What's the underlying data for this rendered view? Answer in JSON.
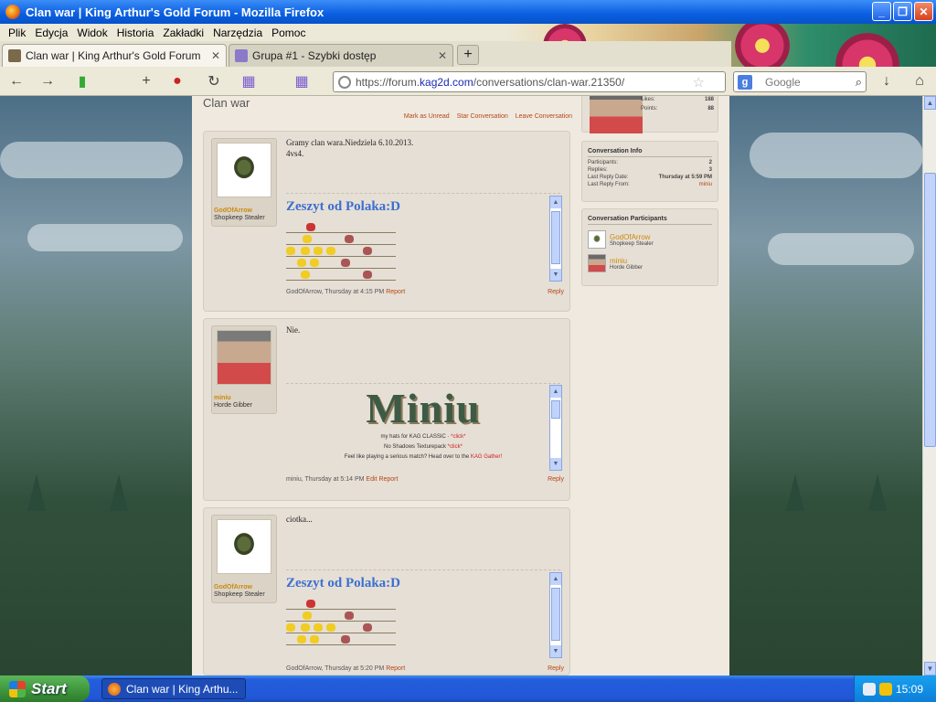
{
  "window": {
    "title": "Clan war | King Arthur's Gold Forum - Mozilla Firefox"
  },
  "menu": [
    "Plik",
    "Edycja",
    "Widok",
    "Historia",
    "Zakładki",
    "Narzędzia",
    "Pomoc"
  ],
  "tabs": [
    {
      "label": "Clan war | King Arthur's Gold Forum",
      "active": true
    },
    {
      "label": "Grupa #1 - Szybki dostęp",
      "active": false
    }
  ],
  "urlbar": {
    "prefix": "https://forum.",
    "domain": "kag2d.com",
    "path": "/conversations/clan-war.21350/"
  },
  "search": {
    "placeholder": "Google"
  },
  "page": {
    "title": "Clan war",
    "actions": [
      "Mark as Unread",
      "Star Conversation",
      "Leave Conversation"
    ]
  },
  "messages": [
    {
      "user": "GodOfArrow",
      "user_title": "Shopkeep Stealer",
      "text": [
        "Gramy clan wara.Niedziela 6.10.2013.",
        "4vs4."
      ],
      "signature_title": "Zeszyt od Polaka:D",
      "meta": "GodOfArrow, Thursday at 4:15 PM",
      "links": [
        "Report"
      ],
      "reply": "Reply"
    },
    {
      "user": "miniu",
      "user_title": "Horde Gibber",
      "text": [
        "Nie."
      ],
      "signature_title": "Miniu",
      "sig_line1": "my hats for KAG CLASSIC",
      "sig_line2": "No Shadows Texturepack",
      "sig_click": "*click*",
      "sig_line3": "Feel like playing a serious match? Head over to the",
      "sig_link3": "KAG Gather!",
      "meta": "miniu, Thursday at 5:14 PM",
      "links": [
        "Edit",
        "Report"
      ],
      "reply": "Reply"
    },
    {
      "user": "GodOfArrow",
      "user_title": "Shopkeep Stealer",
      "text": [
        "ciotka..."
      ],
      "signature_title": "Zeszyt od Polaka:D",
      "meta": "GodOfArrow, Thursday at 5:20 PM",
      "links": [
        "Report"
      ],
      "reply": "Reply"
    }
  ],
  "sidebar": {
    "stats": {
      "likes_label": "Likes:",
      "likes": "188",
      "points_label": "Points:",
      "points": "88"
    },
    "conv_info": {
      "heading": "Conversation Info",
      "rows": [
        {
          "label": "Participants:",
          "value": "2"
        },
        {
          "label": "Replies:",
          "value": "3"
        },
        {
          "label": "Last Reply Date:",
          "value": "Thursday at 5:59 PM"
        },
        {
          "label": "Last Reply From:",
          "value": "miniu"
        }
      ]
    },
    "participants": {
      "heading": "Conversation Participants",
      "list": [
        {
          "name": "GodOfArrow",
          "title": "Shopkeep Stealer"
        },
        {
          "name": "miniu",
          "title": "Horde Gibber"
        }
      ]
    }
  },
  "taskbar": {
    "start": "Start",
    "item": "Clan war | King Arthu...",
    "clock": "15:09"
  },
  "colors": {
    "accent": "#b34718",
    "username": "#c98a10",
    "sig_title": "#3b6fd1"
  }
}
